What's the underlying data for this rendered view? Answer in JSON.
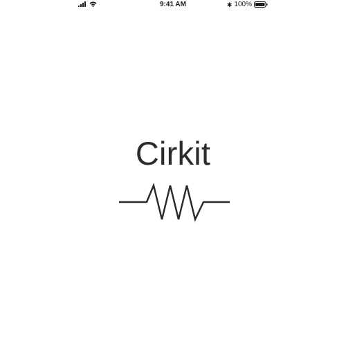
{
  "status_bar": {
    "time": "9:41 AM",
    "bluetooth_symbol": "✱",
    "battery_percent": "100%",
    "battery_level": 1.0,
    "icons": [
      "cellular-signal-icon",
      "wifi-icon",
      "bluetooth-icon",
      "battery-icon"
    ]
  },
  "splash": {
    "app_name": "Cirkit",
    "logo_icon": "resistor-icon",
    "text_color": "#2b2b2d",
    "background": "#ffffff"
  }
}
